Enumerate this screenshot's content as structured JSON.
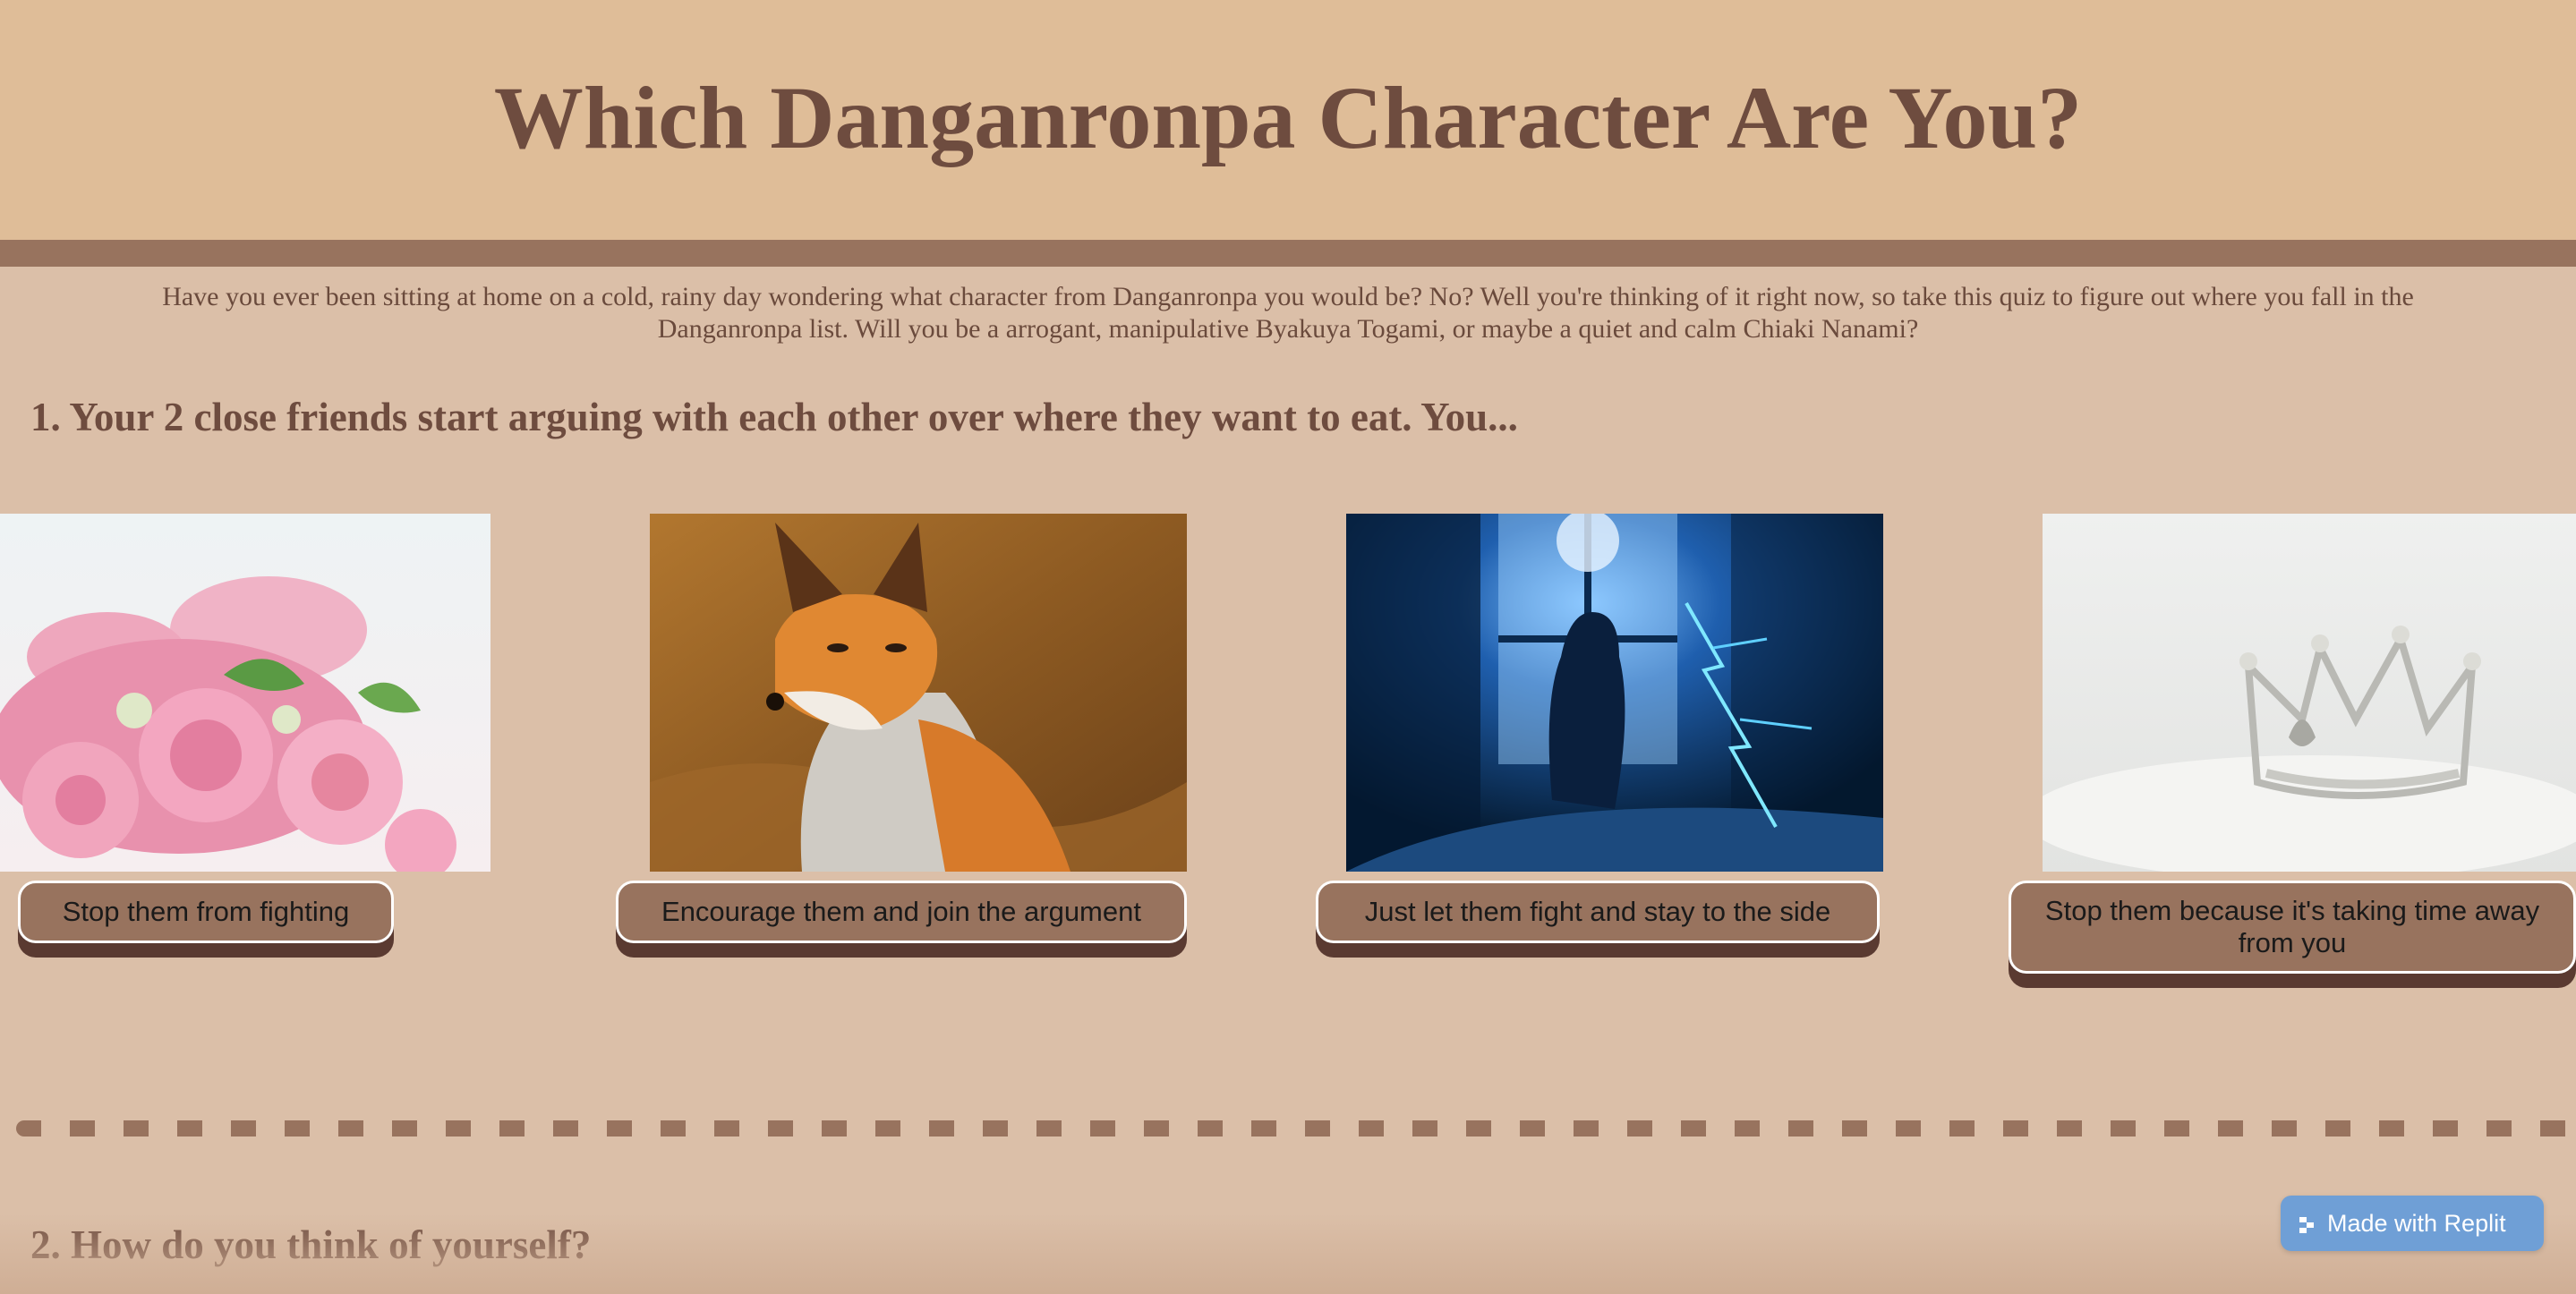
{
  "header": {
    "title": "Which Danganronpa Character Are You?"
  },
  "intro": {
    "text": "Have you ever been sitting at home on a cold, rainy day wondering what character from Danganronpa you would be? No? Well you're thinking of it right now, so take this quiz to figure out where you fall in the Danganronpa list. Will you be a arrogant, manipulative Byakuya Togami, or maybe a quiet and calm Chiaki Nanami?"
  },
  "questions": [
    {
      "title": "1. Your 2 close friends start arguing with each other over where they want to eat. You...",
      "options": [
        {
          "label": "Stop them from fighting",
          "image": "pink-flowers-image"
        },
        {
          "label": "Encourage them and join the argument",
          "image": "fox-image"
        },
        {
          "label": "Just let them fight and stay to the side",
          "image": "girl-window-lightning-image"
        },
        {
          "label": "Stop them because it's taking time away from you",
          "image": "crown-image"
        }
      ]
    },
    {
      "title": "2. How do you think of yourself?"
    }
  ],
  "badge": {
    "label": "Made with Replit"
  },
  "colors": {
    "header_bg": "#dfbd98",
    "header_bar": "#98735e",
    "page_bg": "#dbbfa8",
    "title_text": "#6e4c3f",
    "button_bg": "#98735e",
    "button_shadow": "#5a3a31",
    "badge_bg": "#6f9fd6"
  }
}
